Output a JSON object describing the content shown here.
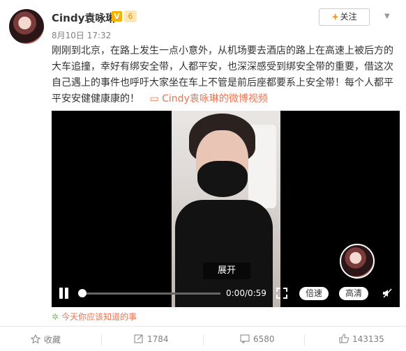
{
  "user": {
    "name": "Cindy袁咏琳",
    "verified_badge": "V",
    "level_badge": "6"
  },
  "follow_button": {
    "plus": "+",
    "label": "关注"
  },
  "meta": {
    "date": "8月10日 17:32"
  },
  "post": {
    "text": "刚刚到北京，在路上发生一点小意外，从机场要去酒店的路上在高速上被后方的大车追撞，幸好有绑安全带，人都平安，也深深感受到绑安全带的重要，借这次自己遇上的事件也呼吁大家坐在车上不管是前后座都要系上安全带！每个人都平平安安健健康康的！",
    "video_link_icon": "video-icon",
    "video_link": "Cindy袁咏琳的微博视频"
  },
  "video": {
    "expand_label": "展开",
    "time": "0:00/0:59",
    "speed_label": "倍速",
    "quality_label": "高清",
    "progress": 0.0
  },
  "topic": {
    "icon": "topic-icon",
    "label": "今天你应该知道的事"
  },
  "footer": {
    "favorite_label": "收藏",
    "repost_count": "1784",
    "comment_count": "6580",
    "like_count": "143135"
  },
  "colors": {
    "accent": "#eb7350",
    "follow_plus": "#ff8200",
    "verified": "#f7b100"
  }
}
